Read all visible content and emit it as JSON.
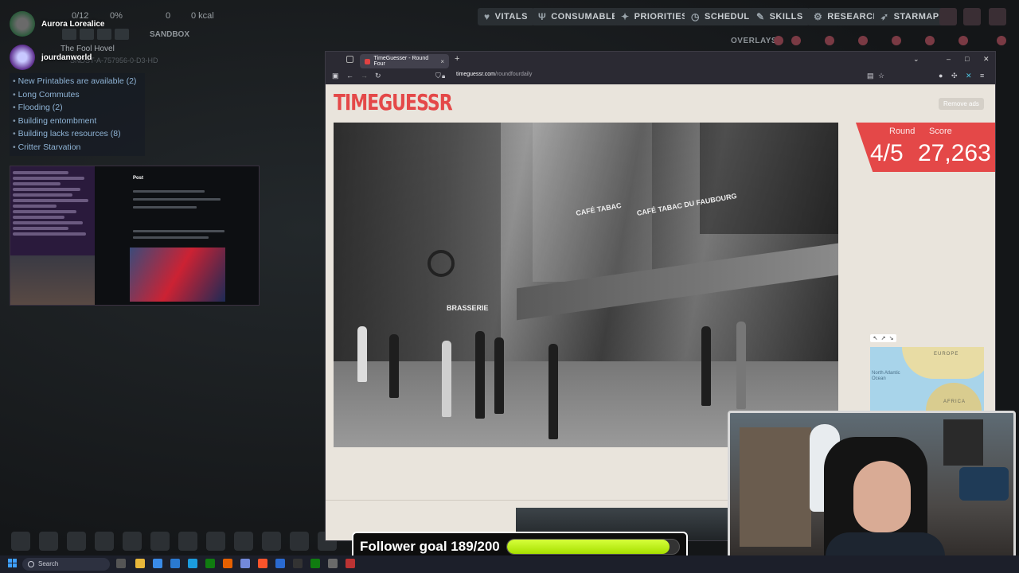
{
  "game": {
    "resources": [
      "0/12",
      "0%",
      "0",
      "0 kcal"
    ],
    "colony_name": "The Fool Hovel",
    "seed": "SNDST-A-757956-0-D3-HD",
    "sandbox_label": "SANDBOX",
    "overlays_label": "OVERLAYS",
    "menu": [
      "VITALS",
      "CONSUMABLES",
      "PRIORITIES",
      "SCHEDULE",
      "SKILLS",
      "RESEARCH",
      "STARMAP"
    ],
    "alerts": [
      "New Printables are available (2)",
      "Long Commutes",
      "Flooding (2)",
      "Building entombment",
      "Building lacks resources (8)",
      "Critter Starvation"
    ]
  },
  "chat": {
    "viewers": [
      "Aurora Lorealice",
      "jourdanworld"
    ],
    "thumbnail_post_label": "Post"
  },
  "browser": {
    "tab_title": "TimeGuesser - Round Four",
    "url_host": "timeguessr.com",
    "url_path": "/roundfourdaily",
    "controls": {
      "minimize": "–",
      "maximize": "□",
      "close": "✕"
    }
  },
  "timeguessr": {
    "logo": "TIMEGUESSR",
    "remove_ads": "Remove ads",
    "round_label": "Round",
    "score_label": "Score",
    "round_value": "4/5",
    "score_value": "27,263",
    "photo_signs": [
      "CAFÉ TABAC",
      "CAFÉ TABAC DU FAUBOURG",
      "BRASSERIE"
    ],
    "map_labels": {
      "north": "EUROPE",
      "south": "AFRICA",
      "ocean": "North Atlantic Ocean"
    }
  },
  "overlay": {
    "follower_label": "Follower goal 189/200",
    "follower_current": 189,
    "follower_target": 200,
    "follower_progress": 0.945
  },
  "taskbar": {
    "search_placeholder": "Search"
  },
  "colors": {
    "accent": "#e44848",
    "follower_bar": "#c4f21a",
    "page_bg": "#e9e4dc"
  }
}
